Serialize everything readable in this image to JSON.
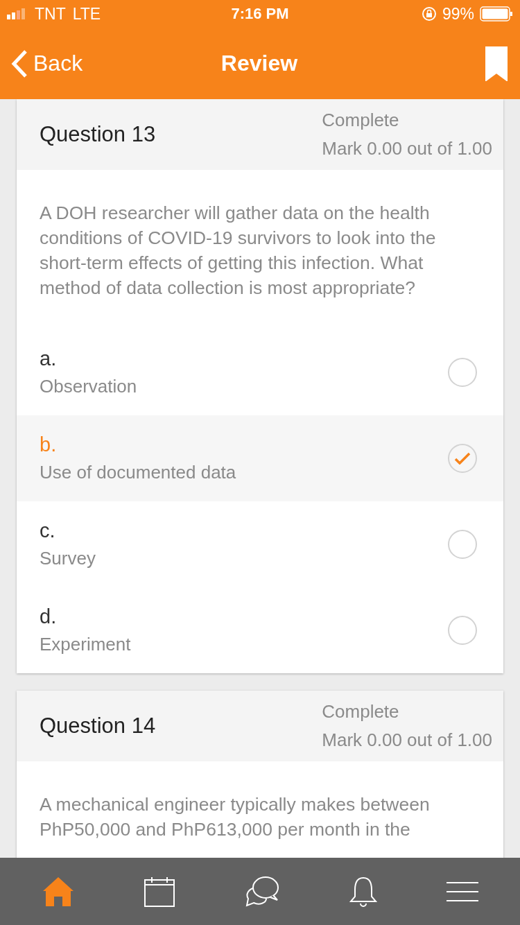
{
  "status_bar": {
    "carrier": "TNT",
    "network": "LTE",
    "time": "7:16 PM",
    "battery": "99%"
  },
  "nav_bar": {
    "back": "Back",
    "title": "Review",
    "bookmarked": true
  },
  "questions": [
    {
      "title": "Question 13",
      "status": "Complete",
      "mark": "Mark 0.00 out of 1.00",
      "text": "A DOH researcher will gather data on the health conditions of COVID-19 survivors to look into the short-term effects of getting this infection. What method of data collection is most appropriate?",
      "options": [
        {
          "letter": "a.",
          "answer": "Observation",
          "selected": false
        },
        {
          "letter": "b.",
          "answer": "Use of documented data",
          "selected": true
        },
        {
          "letter": "c.",
          "answer": "Survey",
          "selected": false
        },
        {
          "letter": "d.",
          "answer": "Experiment",
          "selected": false
        }
      ]
    },
    {
      "title": "Question 14",
      "status": "Complete",
      "mark": "Mark 0.00 out of 1.00",
      "text": "A mechanical engineer typically makes between PhP50,000 and PhP613,000 per month in the"
    }
  ],
  "tab_bar": [
    {
      "kind": "home",
      "selected": true
    },
    {
      "kind": "calendar",
      "selected": false
    },
    {
      "kind": "chat",
      "selected": false
    },
    {
      "kind": "bell",
      "selected": false
    },
    {
      "kind": "menu",
      "selected": false
    }
  ]
}
